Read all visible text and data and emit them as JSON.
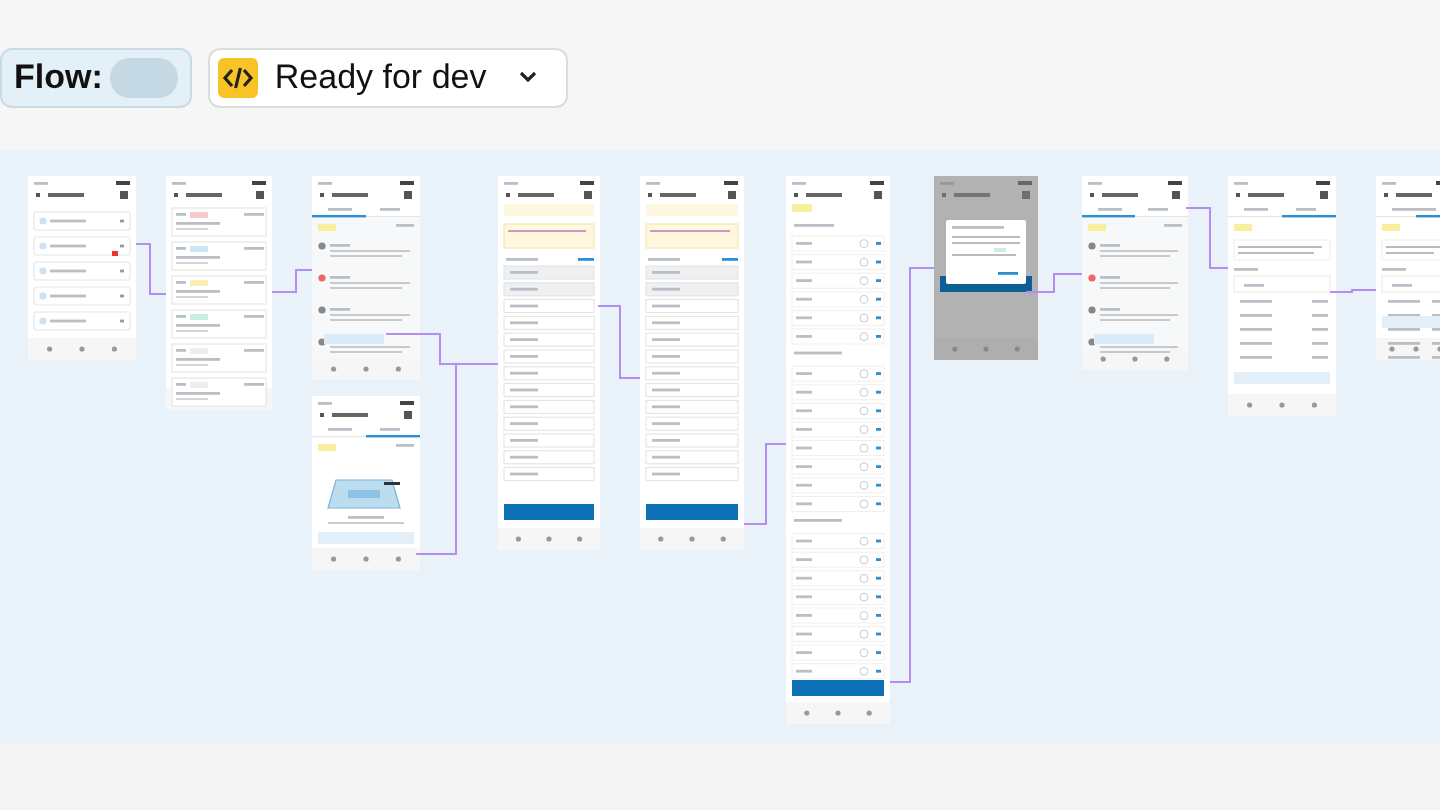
{
  "toolbar": {
    "flow_label": "Flow:",
    "status": {
      "label": "Ready for dev"
    }
  },
  "frames": [
    {
      "kind": "menu"
    },
    {
      "kind": "list"
    },
    {
      "kind": "timeline"
    },
    {
      "kind": "details-empty"
    },
    {
      "kind": "payments"
    },
    {
      "kind": "payments"
    },
    {
      "kind": "count-form"
    },
    {
      "kind": "dialog"
    },
    {
      "kind": "timeline"
    },
    {
      "kind": "details-total"
    },
    {
      "kind": "details-total"
    }
  ]
}
